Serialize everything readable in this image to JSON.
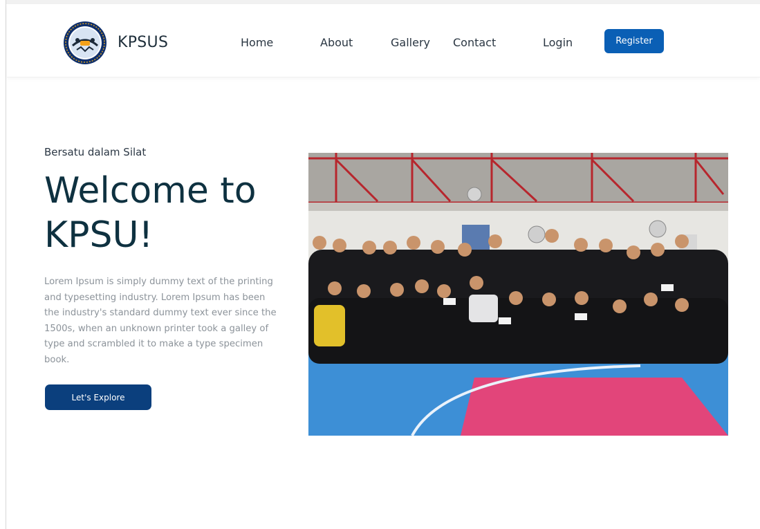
{
  "nav": {
    "brand": "KPSUS",
    "logo_icon": "kpsus-emblem-icon",
    "links": [
      {
        "label": "Home"
      },
      {
        "label": "About"
      },
      {
        "label": "Gallery"
      },
      {
        "label": "Contact"
      },
      {
        "label": "Login"
      }
    ],
    "register_label": "Register"
  },
  "hero": {
    "tagline": "Bersatu dalam Silat",
    "title_line1": "Welcome to",
    "title_line2": "KPSU!",
    "description": "Lorem Ipsum is simply dummy text of the printing and typesetting industry. Lorem Ipsum has been the industry's standard dummy text ever since the 1500s, when an unknown printer took a galley of type and scrambled it to make a type specimen book.",
    "cta_label": "Let's Explore",
    "photo_icon": "group-photo-image"
  },
  "colors": {
    "primary_button": "#0a5fb5",
    "cta_button": "#0b3f7d",
    "title": "#0e3140",
    "body_text": "#8c939a"
  }
}
